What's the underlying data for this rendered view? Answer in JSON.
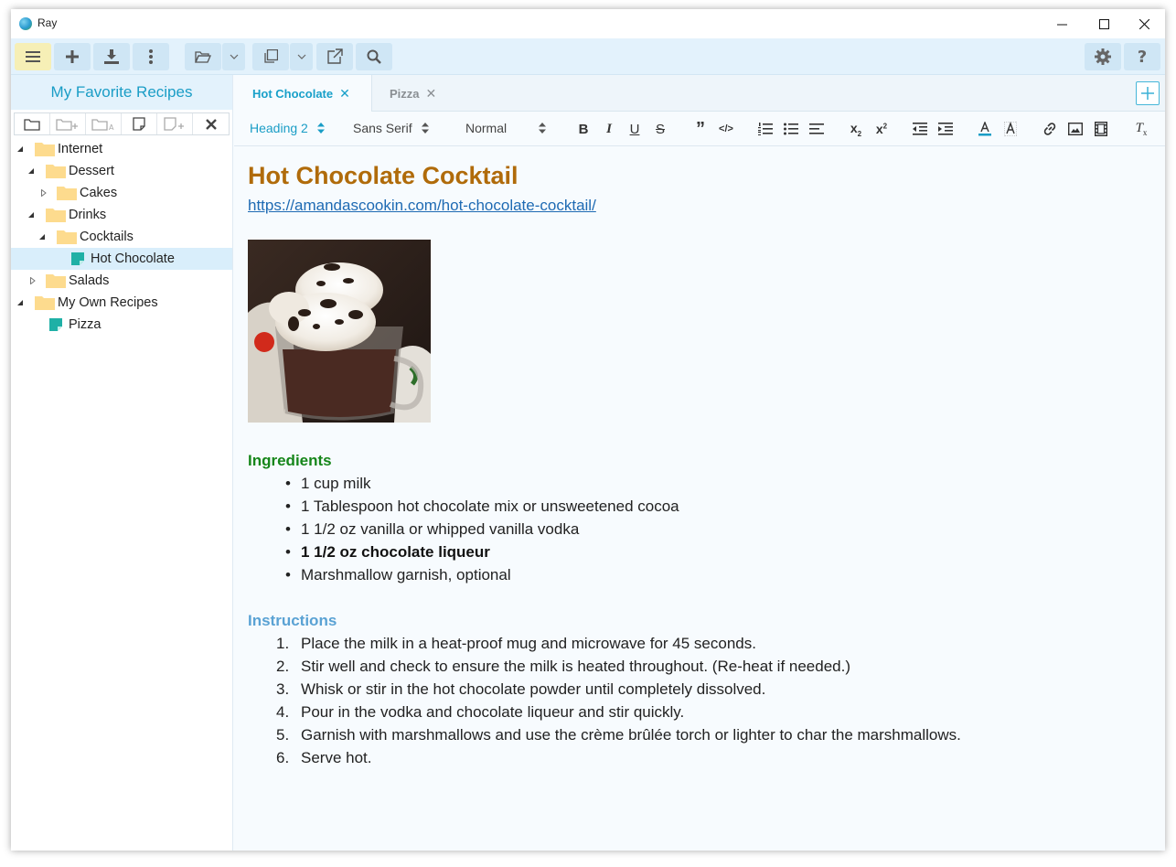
{
  "app": {
    "title": "Ray"
  },
  "sidebar": {
    "title": "My Favorite Recipes",
    "tree": [
      {
        "label": "Internet",
        "kind": "folder",
        "level": 0,
        "expanded": true
      },
      {
        "label": "Dessert",
        "kind": "folder",
        "level": 1,
        "expanded": true
      },
      {
        "label": "Cakes",
        "kind": "folder",
        "level": 2,
        "expanded": false
      },
      {
        "label": "Drinks",
        "kind": "folder",
        "level": 1,
        "expanded": true
      },
      {
        "label": "Cocktails",
        "kind": "folder",
        "level": 2,
        "expanded": true
      },
      {
        "label": "Hot Chocolate",
        "kind": "note",
        "level": 3,
        "selected": true
      },
      {
        "label": "Salads",
        "kind": "folder",
        "level": 1,
        "expanded": false
      },
      {
        "label": "My Own Recipes",
        "kind": "folder",
        "level": 0,
        "expanded": true
      },
      {
        "label": "Pizza",
        "kind": "note",
        "level": 1
      }
    ]
  },
  "tabs": [
    {
      "label": "Hot Chocolate",
      "active": true
    },
    {
      "label": "Pizza",
      "active": false
    }
  ],
  "format_bar": {
    "block_style": "Heading 2",
    "font": "Sans Serif",
    "size": "Normal"
  },
  "document": {
    "title": "Hot Chocolate Cocktail",
    "url": "https://amandascookin.com/hot-chocolate-cocktail/",
    "ingredients_heading": "Ingredients",
    "ingredients": [
      "1 cup milk",
      "1 Tablespoon hot chocolate mix or unsweetened cocoa",
      "1 1/2 oz vanilla or whipped vanilla vodka",
      "1 1/2 oz chocolate liqueur",
      "Marshmallow garnish, optional"
    ],
    "instructions_heading": "Instructions",
    "instructions": [
      "Place the milk in a heat-proof mug and microwave for 45 seconds.",
      "Stir well and check to ensure the milk is heated throughout. (Re-heat if needed.)",
      "Whisk or stir in the hot chocolate powder until completely dissolved.",
      "Pour in the vodka and chocolate liqueur and stir quickly.",
      "Garnish with marshmallows and use the crème brûlée torch or lighter to char the marshmallows.",
      "Serve hot."
    ]
  },
  "colors": {
    "accent": "#1a9dc6",
    "title": "#b06b0a",
    "ingredients_heading": "#16861a",
    "instructions_heading": "#5aa2d4"
  }
}
